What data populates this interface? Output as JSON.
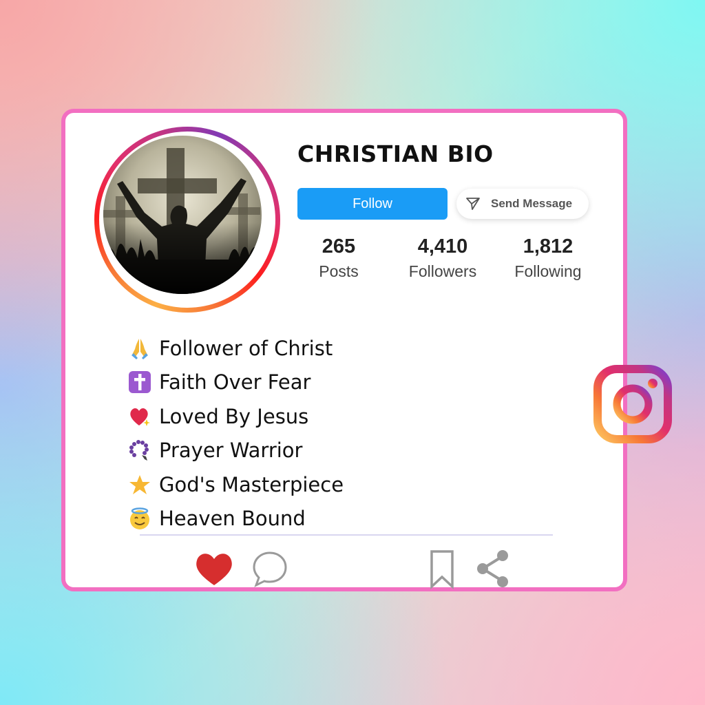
{
  "profile": {
    "title": "CHRISTIAN BIO",
    "follow_label": "Follow",
    "message_label": "Send Message",
    "stats": [
      {
        "value": "265",
        "label": "Posts"
      },
      {
        "value": "4,410",
        "label": "Followers"
      },
      {
        "value": "1,812",
        "label": "Following"
      }
    ]
  },
  "bio": [
    {
      "icon": "praying-hands-icon",
      "text": "Follower of Christ"
    },
    {
      "icon": "latin-cross-icon",
      "text": "Faith Over Fear"
    },
    {
      "icon": "sparkling-heart-icon",
      "text": "Loved By Jesus"
    },
    {
      "icon": "prayer-beads-icon",
      "text": "Prayer Warrior"
    },
    {
      "icon": "glowing-star-icon",
      "text": "God's Masterpiece"
    },
    {
      "icon": "halo-face-icon",
      "text": "Heaven Bound"
    }
  ],
  "colors": {
    "follow_button": "#1a9cf6",
    "card_border": "#f26fc1",
    "like_heart": "#d62e2e"
  },
  "actions": [
    "like-icon",
    "comment-icon",
    "bookmark-icon",
    "share-icon"
  ]
}
